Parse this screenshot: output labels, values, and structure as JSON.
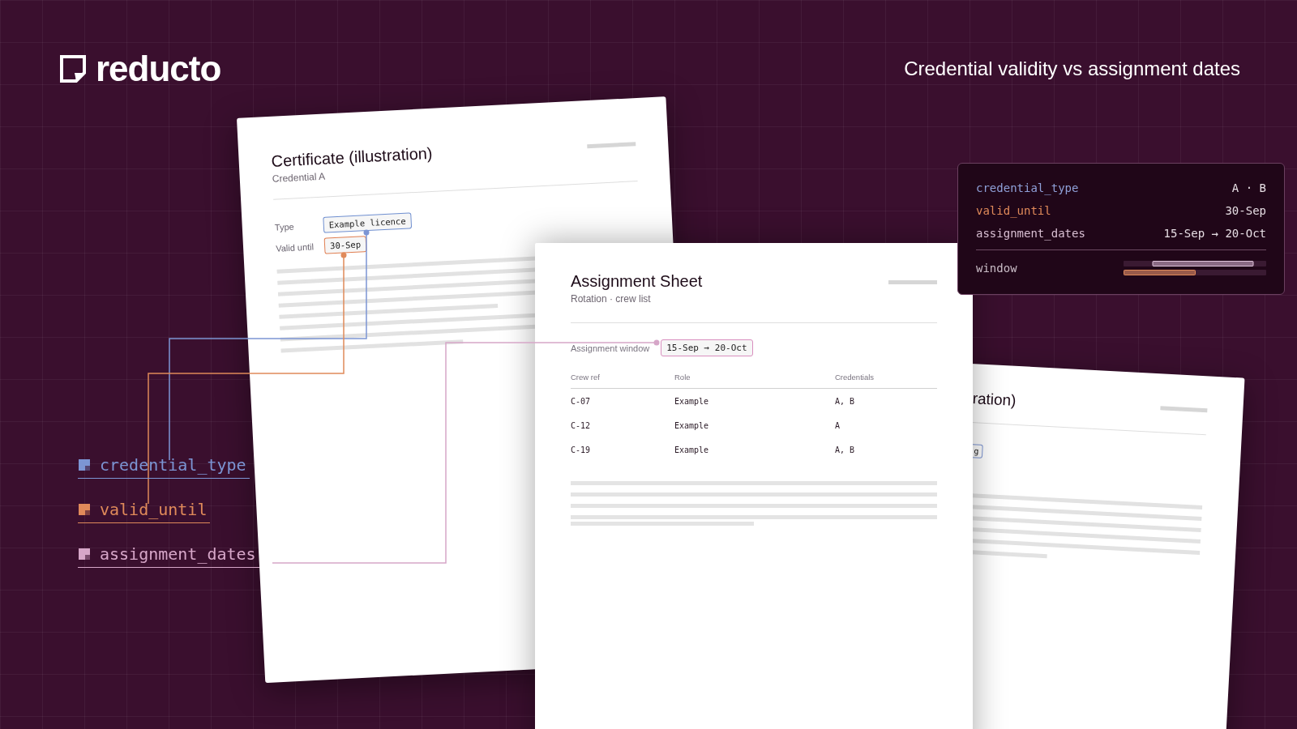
{
  "brand": {
    "name": "reducto"
  },
  "headline": "Credential validity vs assignment dates",
  "certificate": {
    "title": "Certificate (illustration)",
    "subtitle": "Credential A",
    "fields": [
      {
        "label": "Type",
        "value": "Example licence",
        "color": "#6f8fd0"
      },
      {
        "label": "Valid until",
        "value": "30-Sep",
        "color": "#e07f52"
      }
    ]
  },
  "assignment_sheet": {
    "title": "Assignment Sheet",
    "subtitle": "Rotation · crew list",
    "window": {
      "label": "Assignment window",
      "value": "15-Sep → 20-Oct",
      "color": "#d98fbf"
    },
    "table": {
      "columns": [
        "Crew ref",
        "Role",
        "Credentials"
      ],
      "rows": [
        [
          "C-07",
          "Example",
          "A, B"
        ],
        [
          "C-12",
          "Example",
          "A"
        ],
        [
          "C-19",
          "Example",
          "A, B"
        ]
      ]
    }
  },
  "back_document": {
    "title": "ration)",
    "field_value": "g"
  },
  "legend": [
    {
      "label": "credential_type",
      "color": "#7c95d4"
    },
    {
      "label": "valid_until",
      "color": "#e08a5a"
    },
    {
      "label": "assignment_dates",
      "color": "#d6a6c8"
    }
  ],
  "summary": {
    "rows": [
      {
        "key": "credential_type",
        "value": "A · B",
        "color": "#8fa0d8"
      },
      {
        "key": "valid_until",
        "value": "30-Sep",
        "color": "#e08a5a"
      },
      {
        "key": "assignment_dates",
        "value": "15-Sep → 20-Oct",
        "color": "#d8bfd2"
      }
    ],
    "window_label": "window"
  }
}
